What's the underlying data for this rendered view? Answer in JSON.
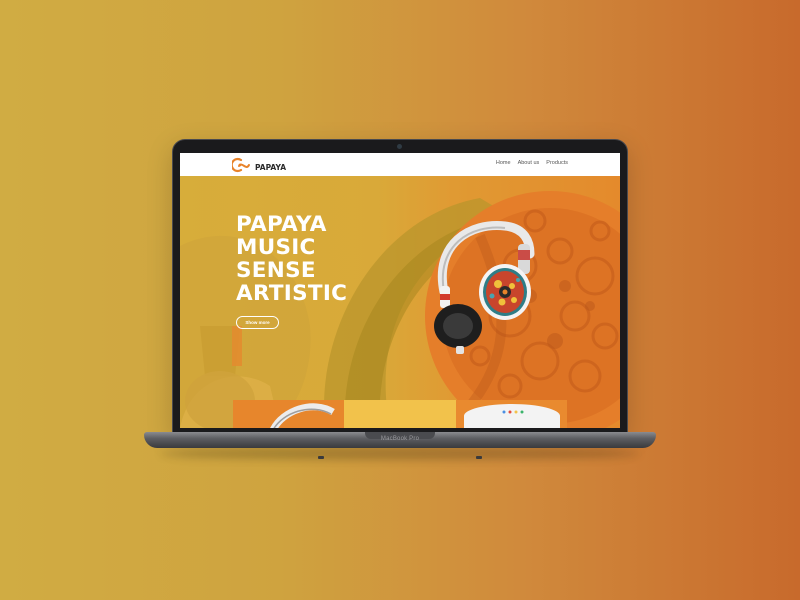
{
  "device": {
    "model_label": "MacBook Pro"
  },
  "site": {
    "brand": "PAPAYA",
    "nav": [
      {
        "label": "Home"
      },
      {
        "label": "About us"
      },
      {
        "label": "Products"
      }
    ],
    "hero": {
      "title_lines": [
        "PAPAYA",
        "MUSIC",
        "SENSE",
        "ARTISTIC"
      ],
      "cta_label": "Show more"
    }
  },
  "colors": {
    "accent_orange": "#e8832a",
    "hero_yellow": "#d7ad3a",
    "nav_background": "#ffffff"
  },
  "icons": {
    "logo": "papaya-logo-icon"
  }
}
